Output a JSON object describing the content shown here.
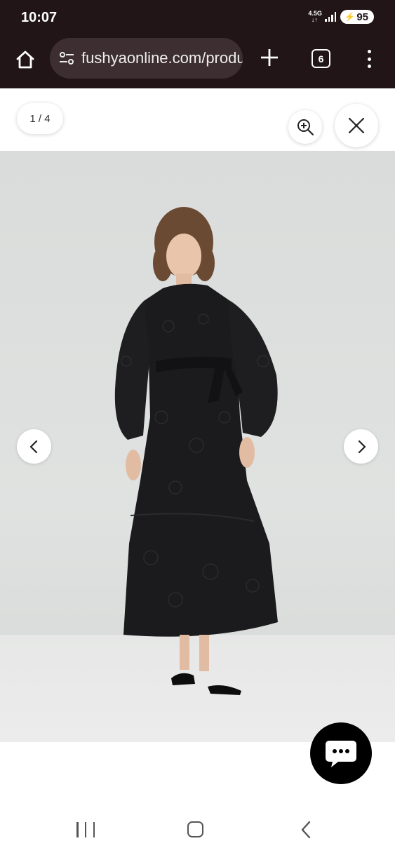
{
  "status_bar": {
    "time": "10:07",
    "network_type_top": "4.5G",
    "network_type_bottom": "↓↑",
    "battery_level": "95"
  },
  "browser": {
    "url": "fushyaonline.com/products",
    "tab_count": "6"
  },
  "gallery": {
    "counter": "1 / 4",
    "image_alt": "Model wearing black long-sleeve tiered maxi dress with belt"
  },
  "icons": {
    "home": "home-icon",
    "site_settings": "tune-icon",
    "new_tab": "plus-icon",
    "tabs": "tab-switcher-icon",
    "menu": "more-vert-icon",
    "zoom": "zoom-in-icon",
    "close": "close-icon",
    "prev": "chevron-left-icon",
    "next": "chevron-right-icon",
    "chat": "chat-icon"
  },
  "colors": {
    "browser_chrome": "#211517",
    "url_pill": "#3d2e31",
    "dress": "#1b1b1d",
    "background": "#dadcdb"
  }
}
